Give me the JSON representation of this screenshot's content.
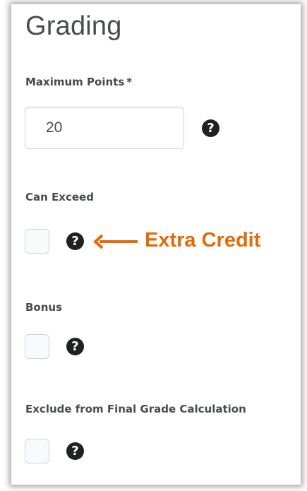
{
  "section": {
    "title": "Grading"
  },
  "max_points": {
    "label": "Maximum Points",
    "required_marker": "*",
    "value": "20",
    "help_icon": "question-circle-icon"
  },
  "can_exceed": {
    "label": "Can Exceed",
    "checked": false,
    "help_icon": "question-circle-icon",
    "annotation": {
      "text": "Extra Credit",
      "color": "#e36c0a",
      "arrow": "left-arrow-icon"
    }
  },
  "bonus": {
    "label": "Bonus",
    "checked": false,
    "help_icon": "question-circle-icon"
  },
  "exclude": {
    "label": "Exclude from Final Grade Calculation",
    "checked": false,
    "help_icon": "question-circle-icon"
  },
  "colors": {
    "text": "#494c4e",
    "border": "#cdd5dc",
    "icon": "#202122",
    "annotation": "#e36c0a"
  }
}
